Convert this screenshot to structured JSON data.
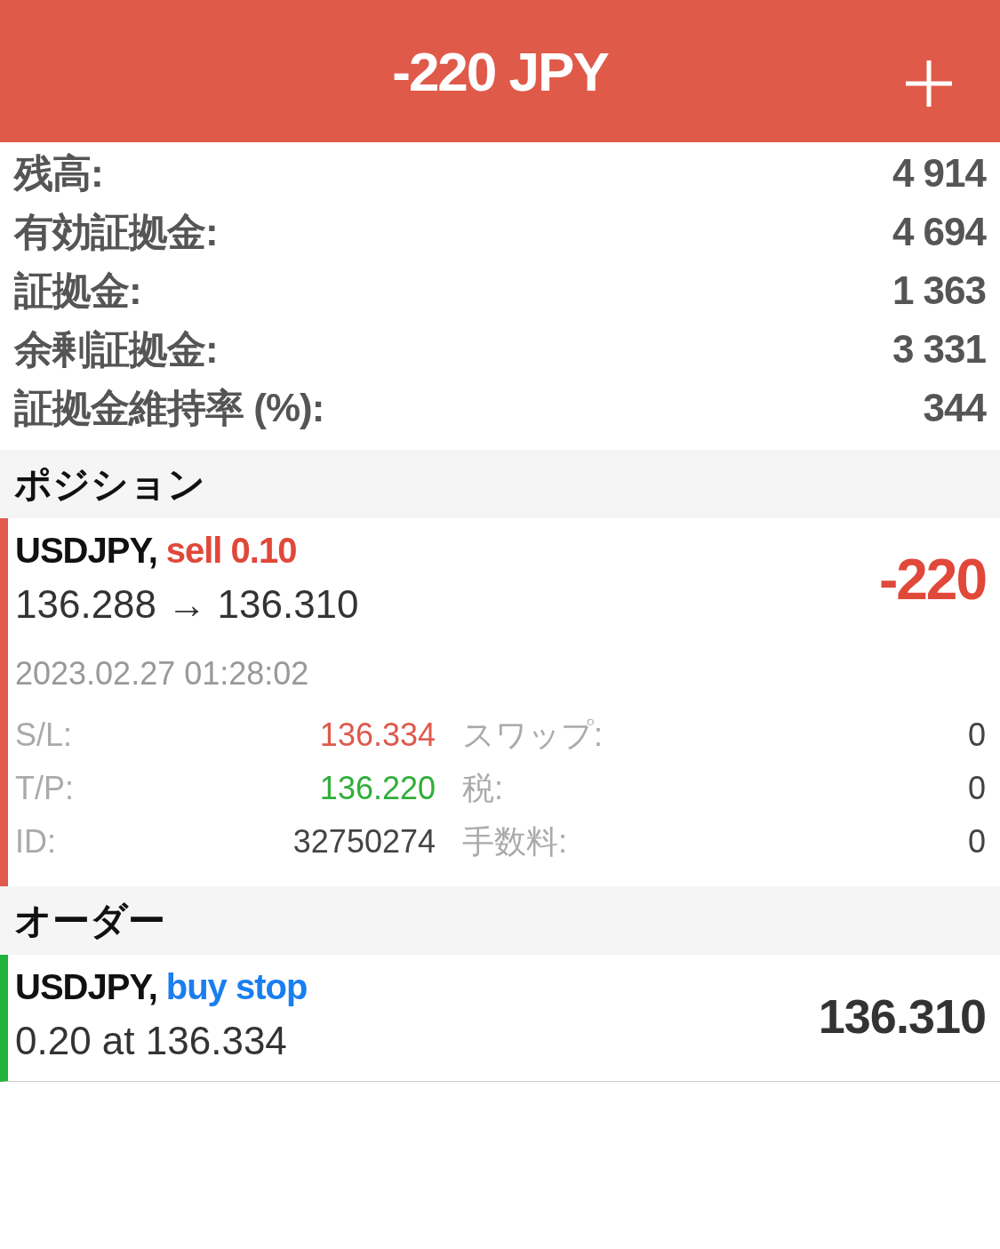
{
  "header": {
    "title": "-220 JPY"
  },
  "summary": [
    {
      "label": "残高:",
      "value": "4 914"
    },
    {
      "label": "有効証拠金:",
      "value": "4 694"
    },
    {
      "label": "証拠金:",
      "value": "1 363"
    },
    {
      "label": "余剰証拠金:",
      "value": "3 331"
    },
    {
      "label": "証拠金維持率 (%):",
      "value": "344"
    }
  ],
  "positions": {
    "title": "ポジション",
    "items": [
      {
        "symbol": "USDJPY,",
        "kind": "sell",
        "trade": "sell 0.10",
        "prices": "136.288 → 136.310",
        "profit": "-220",
        "time": "2023.02.27 01:28:02",
        "details": [
          {
            "label": "S/L:",
            "value": "136.334",
            "color": "#de5a4c",
            "label_2": "スワップ:",
            "value_2": "0"
          },
          {
            "label": "T/P:",
            "value": "136.220",
            "color": "#2fae3a",
            "label_2": "税:",
            "value_2": "0"
          },
          {
            "label": "ID:",
            "value": "32750274",
            "color": "#444444",
            "label_2": "手数料:",
            "value_2": "0"
          }
        ]
      }
    ]
  },
  "orders": {
    "title": "オーダー",
    "items": [
      {
        "symbol": "USDJPY,",
        "kind": "buy",
        "trade": "buy stop",
        "volume_price": "0.20 at 136.334",
        "price": "136.310"
      }
    ]
  }
}
